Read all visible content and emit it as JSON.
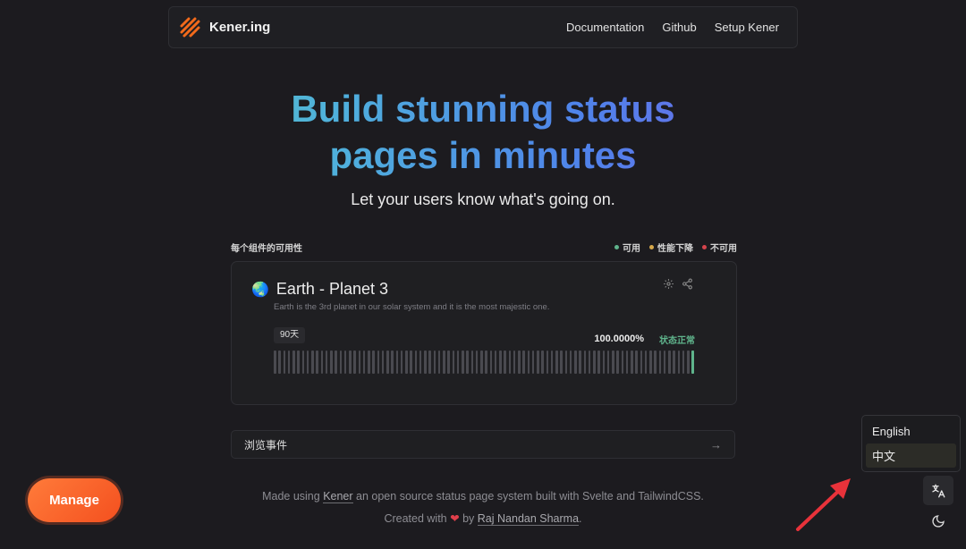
{
  "nav": {
    "brand": "Kener.ing",
    "links": [
      "Documentation",
      "Github",
      "Setup Kener"
    ]
  },
  "hero": {
    "title_line1_word1": "Build",
    "title_line1_rest": "stunning status",
    "title_line2": "pages in minutes",
    "subtitle": "Let your users know what's going on."
  },
  "section": {
    "heading": "每个组件的可用性",
    "legend": [
      {
        "label": "可用",
        "color": "#5fb48c"
      },
      {
        "label": "性能下降",
        "color": "#d6a84a"
      },
      {
        "label": "不可用",
        "color": "#d5444c"
      }
    ]
  },
  "monitor": {
    "icon": "globe-icon",
    "name": "Earth - Planet 3",
    "description": "Earth is the 3rd planet in our solar system and it is the most majestic one.",
    "range_label": "90天",
    "uptime": "100.0000%",
    "status": "状态正常",
    "bars_total": 90,
    "bars_up_last": 1,
    "colors": {
      "up": "#5fb48c",
      "nodata": "#4a4a50"
    }
  },
  "events": {
    "label": "浏览事件"
  },
  "footer": {
    "made_using": "Made using",
    "kener_link": "Kener",
    "made_rest": "an open source status page system built with Svelte and TailwindCSS.",
    "created_with": "Created with",
    "by": "by",
    "author": "Raj Nandan Sharma",
    "period": "."
  },
  "manage_button": "Manage",
  "language_menu": {
    "options": [
      "English",
      "中文"
    ],
    "selected": "中文"
  },
  "accent_colors": {
    "brand_orange": "#f4501f",
    "annotation_red": "#e8323a"
  }
}
